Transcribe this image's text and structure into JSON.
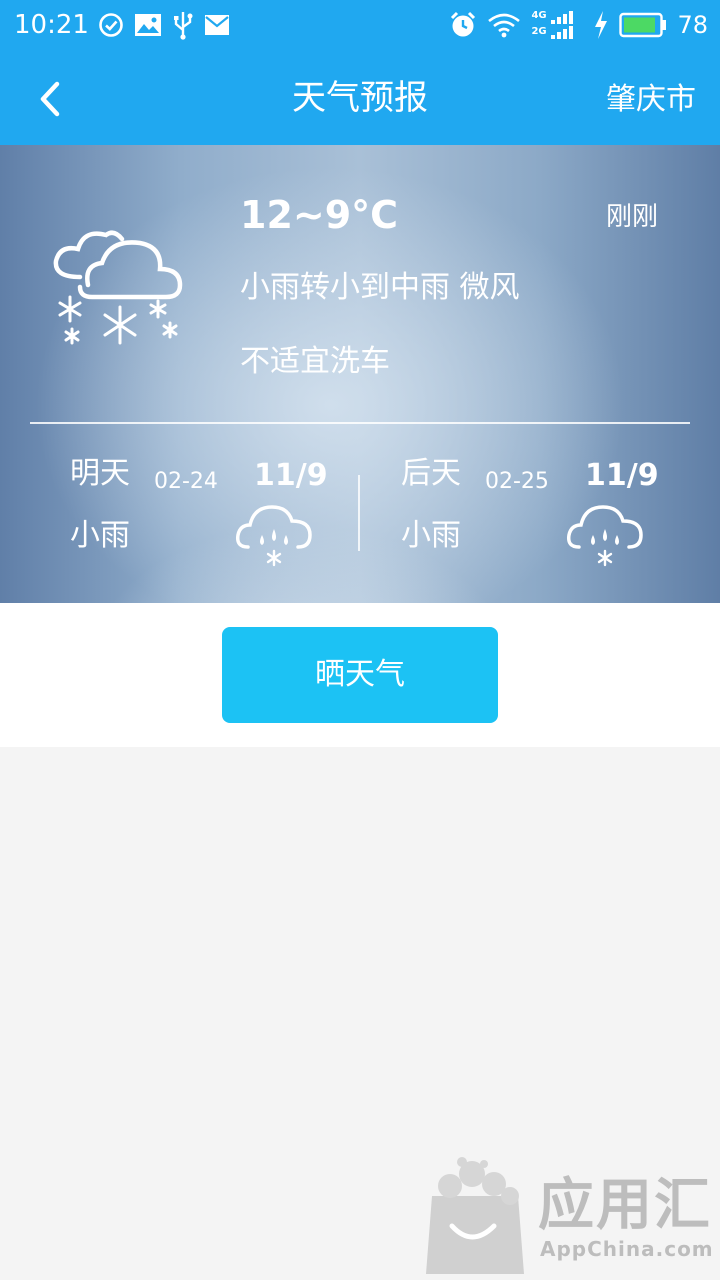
{
  "status_bar": {
    "time": "10:21",
    "battery_level": "78",
    "network_top": "4G",
    "network_bottom": "2G",
    "icons_left": [
      "check-circle-icon",
      "image-icon",
      "usb-icon",
      "mail-icon"
    ],
    "icons_right": [
      "alarm-icon",
      "wifi-icon",
      "signal-icon",
      "charging-icon",
      "battery-icon"
    ]
  },
  "header": {
    "title": "天气预报",
    "city": "肇庆市",
    "back_icon": "chevron-left-icon"
  },
  "current": {
    "temp_range": "12~9°C",
    "updated": "刚刚",
    "condition": "小雨转小到中雨  微风",
    "advice": "不适宜洗车",
    "icon": "cloud-snow-icon"
  },
  "forecast": [
    {
      "day": "明天",
      "date": "02-24",
      "temp": "11/9",
      "condition": "小雨",
      "icon": "cloud-rain-snow-icon"
    },
    {
      "day": "后天",
      "date": "02-25",
      "temp": "11/9",
      "condition": "小雨",
      "icon": "cloud-rain-snow-icon"
    }
  ],
  "share_button": {
    "label": "晒天气"
  },
  "watermark": {
    "text": "应用汇",
    "sub": "AppChina.com"
  },
  "colors": {
    "primary": "#20a8f0",
    "button": "#1cc2f4",
    "background": "#f4f4f4"
  }
}
